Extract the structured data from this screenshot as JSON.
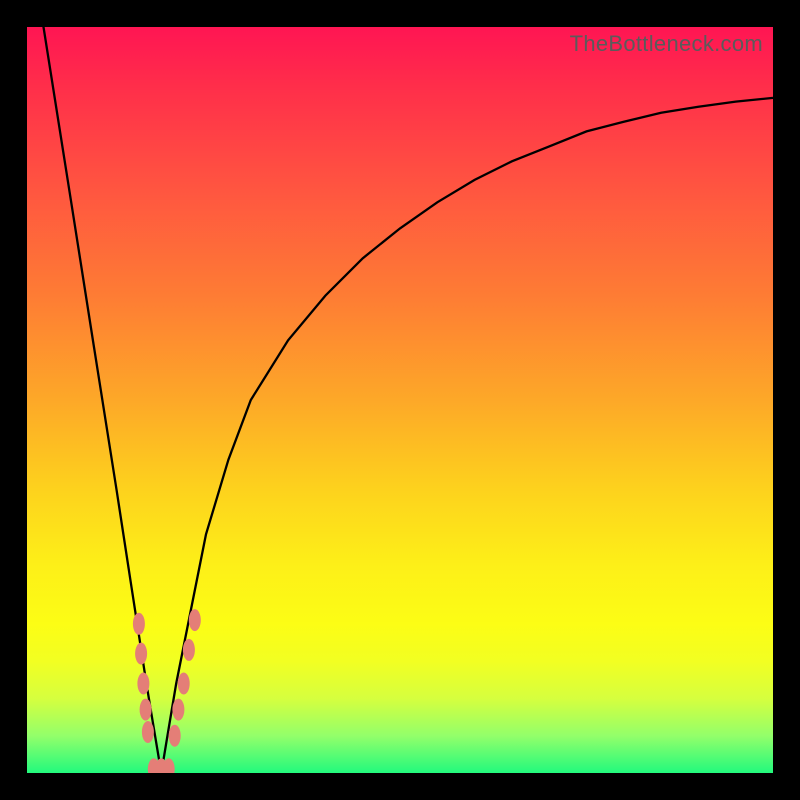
{
  "watermark": "TheBottleneck.com",
  "colors": {
    "frame": "#000000",
    "curve": "#000000",
    "marker": "#e47e77",
    "gradient_top": "#ff1553",
    "gradient_bottom": "#22f97d"
  },
  "chart_data": {
    "type": "line",
    "title": "",
    "xlabel": "",
    "ylabel": "",
    "xlim": [
      0,
      100
    ],
    "ylim": [
      0,
      100
    ],
    "x_optimum": 18,
    "series": [
      {
        "name": "bottleneck-curve",
        "x": [
          0,
          3,
          6,
          9,
          12,
          14,
          16,
          17,
          18,
          19,
          20,
          22,
          24,
          27,
          30,
          35,
          40,
          45,
          50,
          55,
          60,
          65,
          70,
          75,
          80,
          85,
          90,
          95,
          100
        ],
        "values": [
          114,
          95,
          76,
          57,
          38,
          25,
          12,
          6,
          0,
          6,
          12,
          22,
          32,
          42,
          50,
          58,
          64,
          69,
          73,
          76.5,
          79.5,
          82,
          84,
          86,
          87.3,
          88.5,
          89.3,
          90,
          90.5
        ]
      }
    ],
    "markers": {
      "name": "highlighted-points",
      "points": [
        {
          "x": 15.0,
          "y": 20
        },
        {
          "x": 15.3,
          "y": 16
        },
        {
          "x": 15.6,
          "y": 12
        },
        {
          "x": 15.9,
          "y": 8.5
        },
        {
          "x": 16.2,
          "y": 5.5
        },
        {
          "x": 17.0,
          "y": 0.5
        },
        {
          "x": 18.0,
          "y": 0.5
        },
        {
          "x": 19.0,
          "y": 0.5
        },
        {
          "x": 19.8,
          "y": 5
        },
        {
          "x": 20.3,
          "y": 8.5
        },
        {
          "x": 21.0,
          "y": 12
        },
        {
          "x": 21.7,
          "y": 16.5
        },
        {
          "x": 22.5,
          "y": 20.5
        }
      ]
    }
  }
}
